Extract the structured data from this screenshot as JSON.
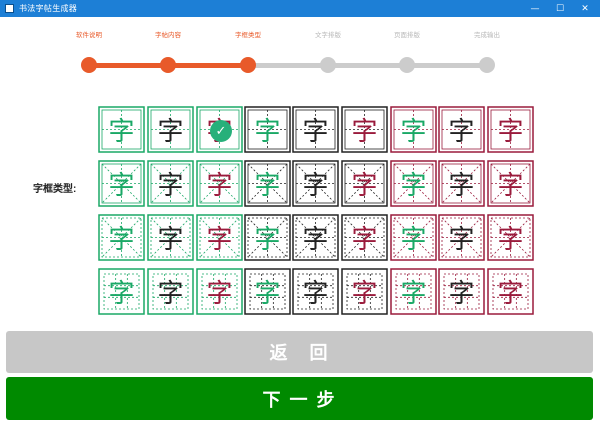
{
  "window": {
    "title": "书法字帖生成器",
    "minimize": "—",
    "maximize": "☐",
    "close": "✕"
  },
  "steps": [
    {
      "label": "软件说明",
      "state": "done"
    },
    {
      "label": "字帖内容",
      "state": "done"
    },
    {
      "label": "字框类型",
      "state": "current"
    },
    {
      "label": "文字排版",
      "state": "todo"
    },
    {
      "label": "页面排版",
      "state": "todo"
    },
    {
      "label": "完成输出",
      "state": "todo"
    }
  ],
  "colors": {
    "done": "#e85a2a",
    "todo": "#cccccc",
    "todo_text": "#b8b8b8",
    "green": "#1aa866",
    "black": "#222222",
    "red": "#9a1b3c"
  },
  "grid": {
    "label": "字框类型:",
    "char": "字",
    "selected": {
      "row": 0,
      "col": 2
    },
    "rows": [
      {
        "style": "tian-solid"
      },
      {
        "style": "mi-solid"
      },
      {
        "style": "mi-dashed-outer"
      },
      {
        "style": "jiugong"
      }
    ],
    "columns": [
      {
        "frame": "green",
        "text": "green"
      },
      {
        "frame": "green",
        "text": "black"
      },
      {
        "frame": "green",
        "text": "red"
      },
      {
        "frame": "black",
        "text": "green"
      },
      {
        "frame": "black",
        "text": "black"
      },
      {
        "frame": "black",
        "text": "red"
      },
      {
        "frame": "red",
        "text": "green"
      },
      {
        "frame": "red",
        "text": "black"
      },
      {
        "frame": "red",
        "text": "red"
      }
    ]
  },
  "buttons": {
    "back": "返　回",
    "next": "下 一 步"
  }
}
